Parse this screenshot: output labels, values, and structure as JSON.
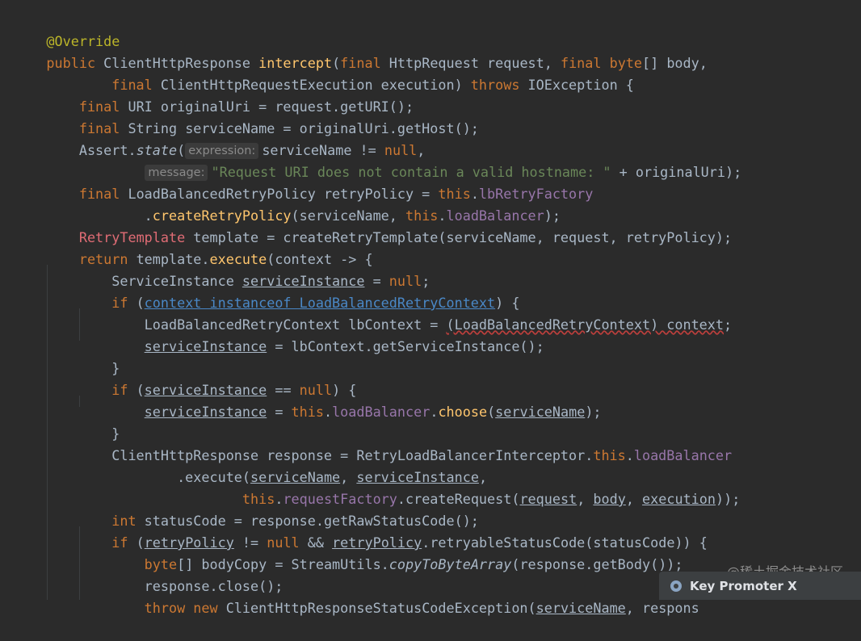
{
  "lines": [
    "@Override",
    "public ClientHttpResponse intercept(final HttpRequest request, final byte[] body,",
    "        final ClientHttpRequestExecution execution) throws IOException {",
    "    final URI originalUri = request.getURI();",
    "    final String serviceName = originalUri.getHost();",
    "    Assert.state( expression: serviceName != null,",
    "             message: \"Request URI does not contain a valid hostname: \" + originalUri);",
    "    final LoadBalancedRetryPolicy retryPolicy = this.lbRetryFactory",
    "            .createRetryPolicy(serviceName, this.loadBalancer);",
    "    RetryTemplate template = createRetryTemplate(serviceName, request, retryPolicy);",
    "    return template.execute(context -> {",
    "        ServiceInstance serviceInstance = null;",
    "        if (context instanceof LoadBalancedRetryContext) {",
    "            LoadBalancedRetryContext lbContext = (LoadBalancedRetryContext) context;",
    "            serviceInstance = lbContext.getServiceInstance();",
    "        }",
    "        if (serviceInstance == null) {",
    "            serviceInstance = this.loadBalancer.choose(serviceName);",
    "        }",
    "        ClientHttpResponse response = RetryLoadBalancerInterceptor.this.loadBalancer",
    "                .execute(serviceName, serviceInstance,",
    "                        this.requestFactory.createRequest(request, body, execution));",
    "        int statusCode = response.getRawStatusCode();",
    "        if (retryPolicy != null && retryPolicy.retryableStatusCode(statusCode)) {",
    "            byte[] bodyCopy = StreamUtils.copyToByteArray(response.getBody());",
    "            response.close();",
    "            throw new ClientHttpResponseStatusCodeException(serviceName, respons"
  ],
  "inlay_hints": {
    "expression": "expression:",
    "message": "message:"
  },
  "watermark": "@稀土掘金技术社区",
  "key_promoter": {
    "label": "Key Promoter X",
    "icon": "key-promoter-icon"
  },
  "colors": {
    "background": "#2b2b2b",
    "keyword": "#cc7832",
    "method": "#ffc66d",
    "annotation": "#bbb529",
    "string": "#6a8759",
    "field": "#9876aa",
    "text": "#a9b7c6"
  }
}
